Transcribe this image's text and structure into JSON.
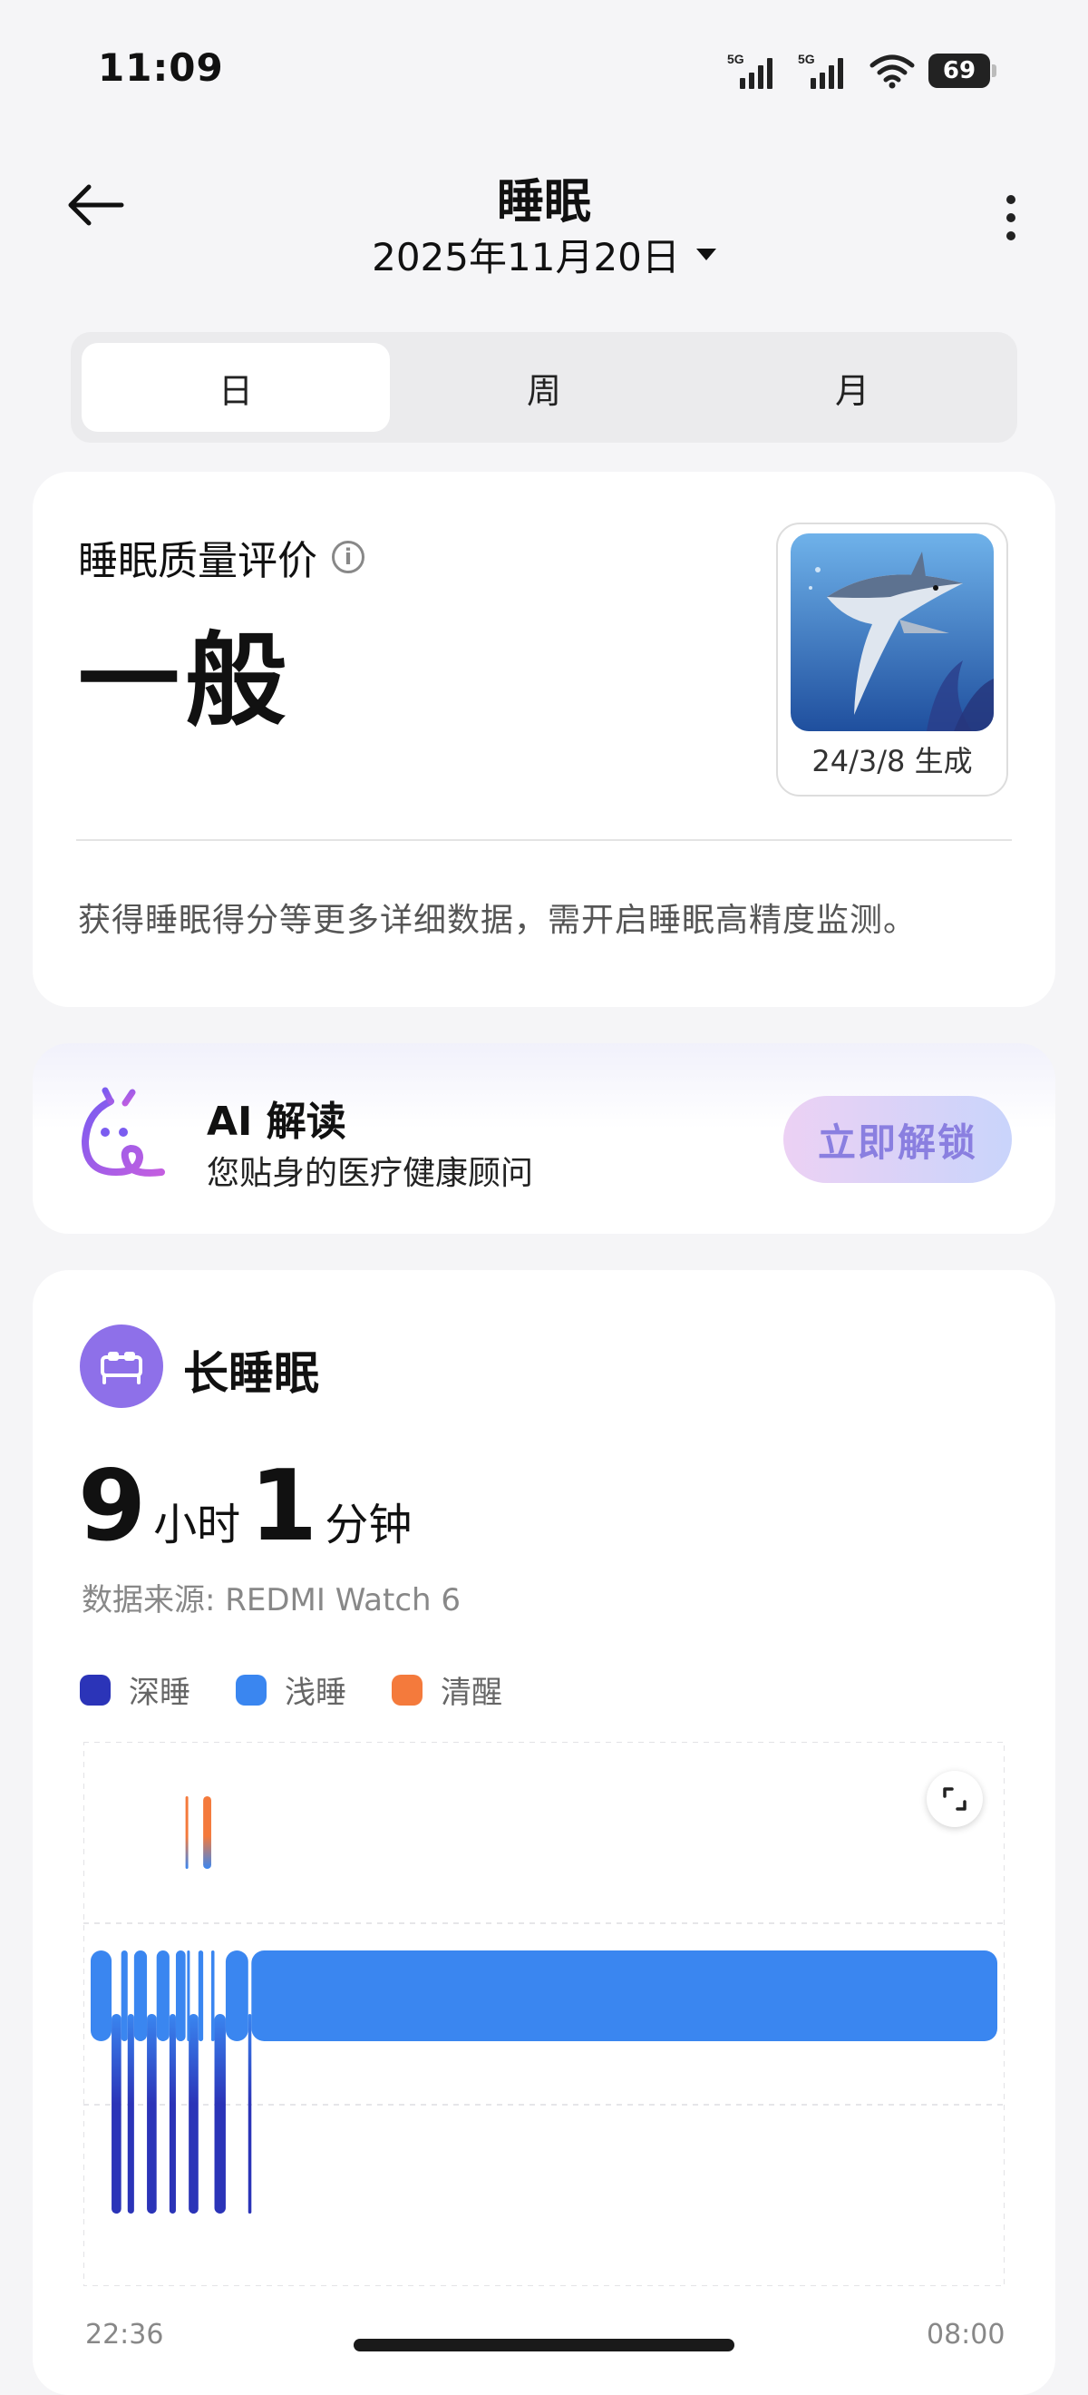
{
  "status_bar": {
    "time": "11:09",
    "signal_1": "5G",
    "signal_2": "5G",
    "battery": "69"
  },
  "header": {
    "title": "睡眠",
    "date": "2025年11月20日"
  },
  "tabs": [
    {
      "label": "日",
      "active": true
    },
    {
      "label": "周",
      "active": false
    },
    {
      "label": "月",
      "active": false
    }
  ],
  "quality": {
    "label": "睡眠质量评价",
    "value": "一般",
    "badge_caption": "24/3/8 生成",
    "note": "获得睡眠得分等更多详细数据，需开启睡眠高精度监测。"
  },
  "ai": {
    "title": "AI 解读",
    "subtitle": "您贴身的医疗健康顾问",
    "button": "立即解锁"
  },
  "sleep": {
    "title": "长睡眠",
    "hours": "9",
    "hours_unit": "小时",
    "minutes": "1",
    "minutes_unit": "分钟",
    "source": "数据来源: REDMI Watch 6",
    "legend": [
      {
        "label": "深睡",
        "color": "#2b34b8"
      },
      {
        "label": "浅睡",
        "color": "#3a86f0"
      },
      {
        "label": "清醒",
        "color": "#f47a3c"
      }
    ],
    "start_time": "22:36",
    "end_time": "08:00"
  },
  "chart_data": {
    "type": "hypnogram",
    "x_start": "22:36",
    "x_end": "08:00",
    "stages": [
      "清醒",
      "浅睡",
      "深睡"
    ],
    "segments": [
      {
        "stage": "浅睡",
        "start": "22:36",
        "end": "22:49"
      },
      {
        "stage": "深睡",
        "start": "22:49",
        "end": "22:55"
      },
      {
        "stage": "浅睡",
        "start": "22:55",
        "end": "22:59"
      },
      {
        "stage": "深睡",
        "start": "22:59",
        "end": "23:03"
      },
      {
        "stage": "浅睡",
        "start": "23:03",
        "end": "23:11"
      },
      {
        "stage": "深睡",
        "start": "23:11",
        "end": "23:17"
      },
      {
        "stage": "浅睡",
        "start": "23:17",
        "end": "23:25"
      },
      {
        "stage": "深睡",
        "start": "23:25",
        "end": "23:29"
      },
      {
        "stage": "浅睡",
        "start": "23:29",
        "end": "23:35"
      },
      {
        "stage": "清醒",
        "start": "23:35",
        "end": "23:36"
      },
      {
        "stage": "浅睡",
        "start": "23:36",
        "end": "23:37"
      },
      {
        "stage": "深睡",
        "start": "23:37",
        "end": "23:43"
      },
      {
        "stage": "浅睡",
        "start": "23:43",
        "end": "23:46"
      },
      {
        "stage": "清醒",
        "start": "23:46",
        "end": "23:51"
      },
      {
        "stage": "浅睡",
        "start": "23:51",
        "end": "23:53"
      },
      {
        "stage": "深睡",
        "start": "23:53",
        "end": "24:00"
      },
      {
        "stage": "浅睡",
        "start": "24:00",
        "end": "00:14"
      },
      {
        "stage": "深睡",
        "start": "00:14",
        "end": "00:16"
      },
      {
        "stage": "浅睡",
        "start": "00:16",
        "end": "08:00"
      }
    ]
  }
}
